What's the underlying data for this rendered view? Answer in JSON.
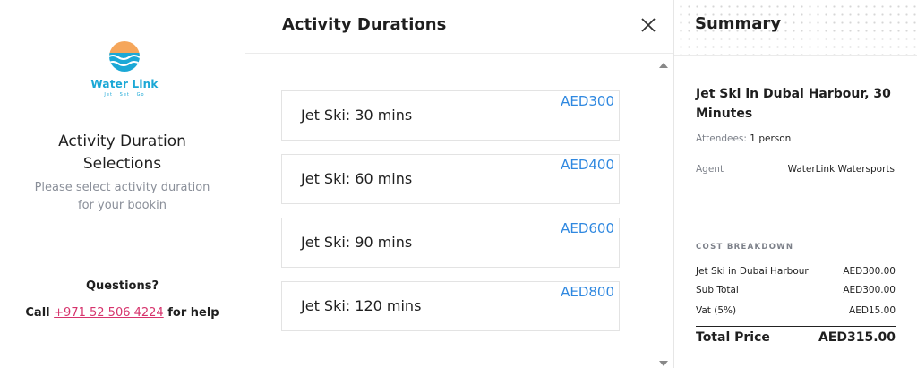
{
  "left": {
    "logo": {
      "name": "Water Link",
      "tagline": "Jet · Set · Go",
      "icon": "waterlink-logo-icon"
    },
    "title": "Activity Duration Selections",
    "subtitle": "Please select activity duration for your bookin",
    "questions": "Questions?",
    "call_prefix": "Call",
    "phone": "+971 52 506 4224",
    "call_suffix": "for help"
  },
  "middle": {
    "title": "Activity Durations",
    "close_icon": "close-icon",
    "options": [
      {
        "label": "Jet Ski: 30 mins",
        "price": "AED300"
      },
      {
        "label": "Jet Ski: 60 mins",
        "price": "AED400"
      },
      {
        "label": "Jet Ski: 90 mins",
        "price": "AED600"
      },
      {
        "label": "Jet Ski: 120 mins",
        "price": "AED800"
      }
    ]
  },
  "summary": {
    "title": "Summary",
    "activity": "Jet Ski in Dubai Harbour, 30 Minutes",
    "attendees_label": "Attendees:",
    "attendees_value": "1 person",
    "agent_label": "Agent",
    "agent_value": "WaterLink Watersports",
    "cost_heading": "COST BREAKDOWN",
    "lines": [
      {
        "label": "Jet Ski in Dubai Harbour",
        "value": "AED300.00"
      },
      {
        "label": "Sub Total",
        "value": "AED300.00"
      },
      {
        "label": "Vat (5%)",
        "value": "AED15.00"
      }
    ],
    "total_label": "Total Price",
    "total_value": "AED315.00"
  },
  "colors": {
    "accent_blue": "#2f88e0",
    "phone_link": "#d6336c",
    "logo_sun": "#f5a65b",
    "logo_water": "#1ba8d6"
  }
}
